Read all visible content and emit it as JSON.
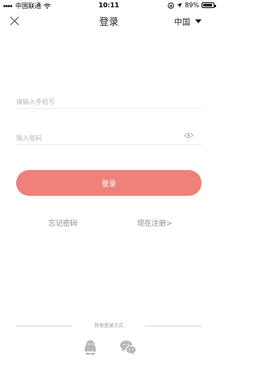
{
  "status_bar": {
    "carrier": "中国联通",
    "time": "10:11",
    "battery": "89%",
    "battery_level": 0.89
  },
  "nav": {
    "title": "登录",
    "region": "中国"
  },
  "form": {
    "phone_placeholder": "请输入手机号",
    "password_placeholder": "输入密码",
    "login_label": "登录"
  },
  "links": {
    "forgot_password": "忘记密码",
    "register": "现在注册>"
  },
  "other_login": {
    "label": "其他登录方式",
    "icons": [
      "qq-icon",
      "wechat-icon"
    ]
  },
  "colors": {
    "accent": "#f0807a"
  }
}
